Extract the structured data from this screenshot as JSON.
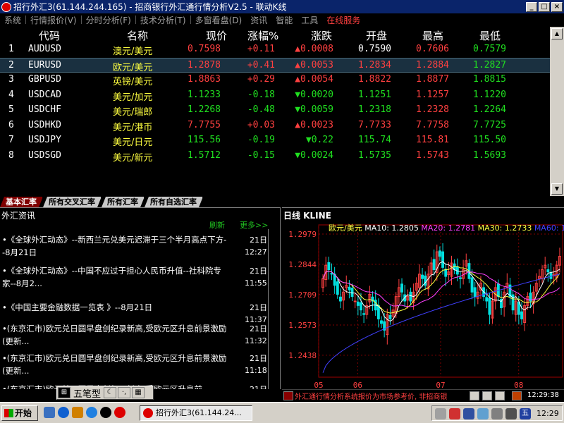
{
  "window": {
    "title": "招行外汇3(61.144.244.165) - 招商银行外汇通行情分析V2.5 - 联动K线",
    "min": "_",
    "max": "□",
    "close": "×"
  },
  "menu": [
    "系统",
    "行情报价(V)",
    "分时分析(F)",
    "技术分析(T)",
    "多窗看盘(D)",
    "资讯",
    "智能",
    "工具",
    "在线服务"
  ],
  "table": {
    "headers": [
      "代码",
      "名称",
      "现价",
      "涨幅%",
      "涨跌",
      "开盘",
      "最高",
      "最低"
    ],
    "rows": [
      {
        "idx": "1",
        "code": "AUDUSD",
        "name": "澳元/美元",
        "price": "0.7598",
        "pct": "+0.11",
        "chg": "▲0.0008",
        "open": "0.7590",
        "high": "0.7606",
        "low": "0.7579",
        "dir": "up"
      },
      {
        "idx": "2",
        "code": "EURUSD",
        "name": "欧元/美元",
        "price": "1.2878",
        "pct": "+0.41",
        "chg": "▲0.0053",
        "open": "1.2834",
        "high": "1.2884",
        "low": "1.2827",
        "dir": "up"
      },
      {
        "idx": "3",
        "code": "GBPUSD",
        "name": "英镑/美元",
        "price": "1.8863",
        "pct": "+0.29",
        "chg": "▲0.0054",
        "open": "1.8822",
        "high": "1.8877",
        "low": "1.8815",
        "dir": "up"
      },
      {
        "idx": "4",
        "code": "USDCAD",
        "name": "美元/加元",
        "price": "1.1233",
        "pct": "-0.18",
        "chg": "▼0.0020",
        "open": "1.1251",
        "high": "1.1257",
        "low": "1.1220",
        "dir": "down"
      },
      {
        "idx": "5",
        "code": "USDCHF",
        "name": "美元/瑞郎",
        "price": "1.2268",
        "pct": "-0.48",
        "chg": "▼0.0059",
        "open": "1.2318",
        "high": "1.2328",
        "low": "1.2264",
        "dir": "down"
      },
      {
        "idx": "6",
        "code": "USDHKD",
        "name": "美元/港币",
        "price": "7.7755",
        "pct": "+0.03",
        "chg": "▲0.0023",
        "open": "7.7733",
        "high": "7.7758",
        "low": "7.7725",
        "dir": "up"
      },
      {
        "idx": "7",
        "code": "USDJPY",
        "name": "美元/日元",
        "price": "115.56",
        "pct": "-0.19",
        "chg": "▼0.22",
        "open": "115.74",
        "high": "115.81",
        "low": "115.50",
        "dir": "down"
      },
      {
        "idx": "8",
        "code": "USDSGD",
        "name": "美元/新元",
        "price": "1.5712",
        "pct": "-0.15",
        "chg": "▼0.0024",
        "open": "1.5735",
        "high": "1.5743",
        "low": "1.5693",
        "dir": "down"
      }
    ]
  },
  "tabs": [
    "基本汇率",
    "所有交叉汇率",
    "所有汇率",
    "所有自选汇率"
  ],
  "news": {
    "title": "外汇资讯",
    "refresh": "刷新",
    "more": "更多>>",
    "items": [
      {
        "text": "•《全球外汇动态》--新西兰元兑美元迟滞于三个半月高点下方--8月21日",
        "day": "21日",
        "time": "12:27"
      },
      {
        "text": "•《全球外汇动态》--中国不应过于担心人民币升值--社科院专家--8月2...",
        "day": "21日",
        "time": "11:55"
      },
      {
        "text": "•《中国主要金融数据一览表 》--8月21日",
        "day": "21日",
        "time": "11:37"
      },
      {
        "text": "•(东京汇市)欧元兑日圆早盘创纪录新高,受欧元区升息前景激励(更新...",
        "day": "21日",
        "time": "11:32"
      },
      {
        "text": "•(东京汇市)欧元兑日圆早盘创纪录新高,受欧元区升息前景激励(更新...",
        "day": "21日",
        "time": "11:18"
      },
      {
        "text": "•(东京汇市)欧元兑日圆早盘创纪录新高,受欧元区升息前",
        "day": "21日",
        "time": ""
      }
    ]
  },
  "ime": {
    "label": "五笔型"
  },
  "kline": {
    "title": "日线 KLINE"
  },
  "chart_data": {
    "type": "candlestick",
    "title": "日线 KLINE",
    "series_name": "欧元/美元",
    "ma": [
      {
        "name": "MA10",
        "value": "1.2805",
        "color": "#ffffff"
      },
      {
        "name": "MA20",
        "value": "1.2781",
        "color": "#ff40ff"
      },
      {
        "name": "MA30",
        "value": "1.2733",
        "color": "#ffff40"
      },
      {
        "name": "MA60",
        "value": "1",
        "color": "#4040ff"
      }
    ],
    "yticks": [
      "1.2979",
      "1.2844",
      "1.2709",
      "1.2573",
      "1.2438"
    ],
    "yrange": [
      1.234,
      1.302
    ],
    "xticks": [
      "05",
      "06",
      "07",
      "08"
    ],
    "closes": [
      1.278,
      1.284,
      1.282,
      1.28,
      1.275,
      1.271,
      1.268,
      1.272,
      1.275,
      1.273,
      1.27,
      1.268,
      1.266,
      1.264,
      1.262,
      1.266,
      1.271,
      1.268,
      1.264,
      1.26,
      1.258,
      1.255,
      1.262,
      1.26,
      1.264,
      1.27,
      1.274,
      1.272,
      1.268,
      1.27,
      1.268,
      1.272,
      1.276,
      1.28,
      1.278,
      1.275,
      1.28,
      1.285,
      1.282,
      1.29,
      1.288,
      1.283,
      1.279,
      1.281,
      1.285,
      1.282,
      1.28,
      1.278,
      1.282,
      1.286,
      1.278,
      1.272,
      1.27,
      1.272,
      1.276,
      1.27,
      1.268,
      1.262,
      1.268,
      1.274,
      1.27,
      1.265,
      1.272,
      1.276,
      1.27,
      1.264,
      1.268,
      1.262,
      1.26,
      1.266,
      1.27,
      1.268,
      1.272,
      1.276,
      1.279,
      1.282,
      1.284,
      1.281,
      1.278,
      1.28,
      1.284,
      1.288
    ]
  },
  "status": {
    "text": "外汇通行情分析系统报价为市场参考价, 非招商银",
    "clock": "12:29:38"
  },
  "taskbar": {
    "start": "开始",
    "task": "招行外汇3(61.144.24...",
    "clock": "12:29"
  }
}
